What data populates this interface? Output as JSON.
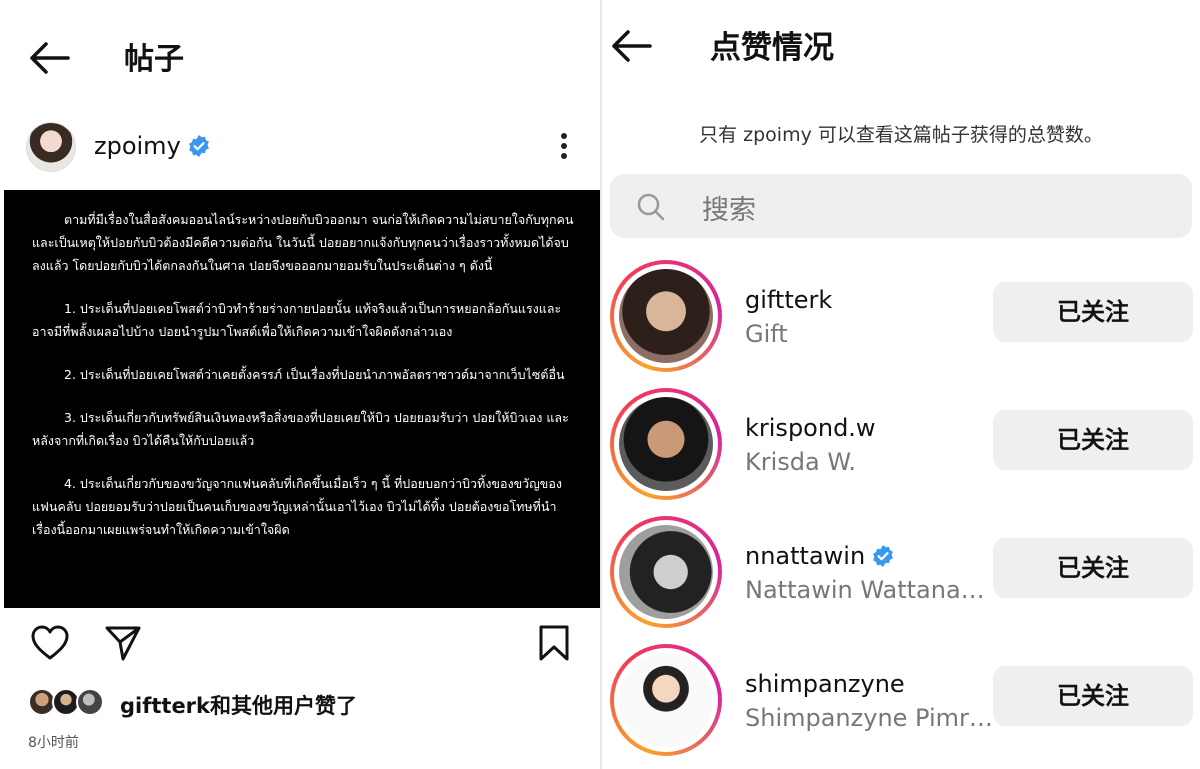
{
  "left": {
    "title": "帖子",
    "post": {
      "username": "zpoimy",
      "verified": true,
      "paragraphs": [
        "ตามที่มีเรื่องในสื่อสังคมออนไลน์ระหว่างปอยกับบิวออกมา จนก่อให้เกิดความไม่สบายใจกับทุกคน และเป็นเหตุให้ปอยกับบิวต้องมีคดีความต่อกัน ในวันนี้ ปอยอยากแจ้งกับทุกคนว่าเรื่องราวทั้งหมดได้จบลงแล้ว โดยปอยกับบิวได้ตกลงกันในศาล ปอยจึงขอออกมายอมรับในประเด็นต่าง ๆ ดังนี้",
        "1. ประเด็นที่ปอยเคยโพสต์ว่าบิวทำร้ายร่างกายปอยนั้น แท้จริงแล้วเป็นการหยอกล้อกันแรงและอาจมีที่พลั้งเผลอไปบ้าง ปอยนำรูปมาโพสต์เพื่อให้เกิดความเข้าใจผิดดังกล่าวเอง",
        "2. ประเด็นที่ปอยเคยโพสต์ว่าเคยตั้งครรภ์ เป็นเรื่องที่ปอยนำภาพอัลตราซาวด์มาจากเว็บไซต์อื่น",
        "3. ประเด็นเกี่ยวกับทรัพย์สินเงินทองหรือสิ่งของที่ปอยเคยให้บิว ปอยยอมรับว่า ปอยให้บิวเอง และหลังจากที่เกิดเรื่อง บิวได้คืนให้กับปอยแล้ว",
        "4. ประเด็นเกี่ยวกับของขวัญจากแฟนคลับที่เกิดขึ้นเมื่อเร็ว ๆ นี้ ที่ปอยบอกว่าบิวทิ้งของขวัญของแฟนคลับ ปอยยอมรับว่าปอยเป็นคนเก็บของขวัญเหล่านั้นเอาไว้เอง บิวไม่ได้ทิ้ง ปอยต้องขอโทษที่นำเรื่องนี้ออกมาเผยแพร่จนทำให้เกิดความเข้าใจผิด"
      ],
      "liked_by_user": "giftterk",
      "liked_suffix": "和其他用户赞了",
      "time_ago": "8小时前"
    }
  },
  "right": {
    "title": "点赞情况",
    "note": "只有 zpoimy 可以查看这篇帖子获得的总赞数。",
    "search_placeholder": "搜索",
    "users": [
      {
        "username": "giftterk",
        "full_name": "Gift",
        "verified": false,
        "button": "已关注"
      },
      {
        "username": "krispond.w",
        "full_name": "Krisda W.",
        "verified": false,
        "button": "已关注"
      },
      {
        "username": "nnattawin",
        "full_name": "Nattawin Wattanag…",
        "verified": true,
        "button": "已关注"
      },
      {
        "username": "shimpanzyne",
        "full_name": "Shimpanzyne Pimr…",
        "verified": false,
        "button": "已关注"
      }
    ]
  },
  "colors": {
    "verified_blue": "#3897f0",
    "button_bg": "#efefef",
    "story_ring": [
      "#f9a428",
      "#f23b5a",
      "#d6249f"
    ]
  },
  "icons": [
    "back-arrow-icon",
    "verified-badge-icon",
    "more-options-icon",
    "heart-icon",
    "share-icon",
    "bookmark-icon",
    "search-icon"
  ]
}
